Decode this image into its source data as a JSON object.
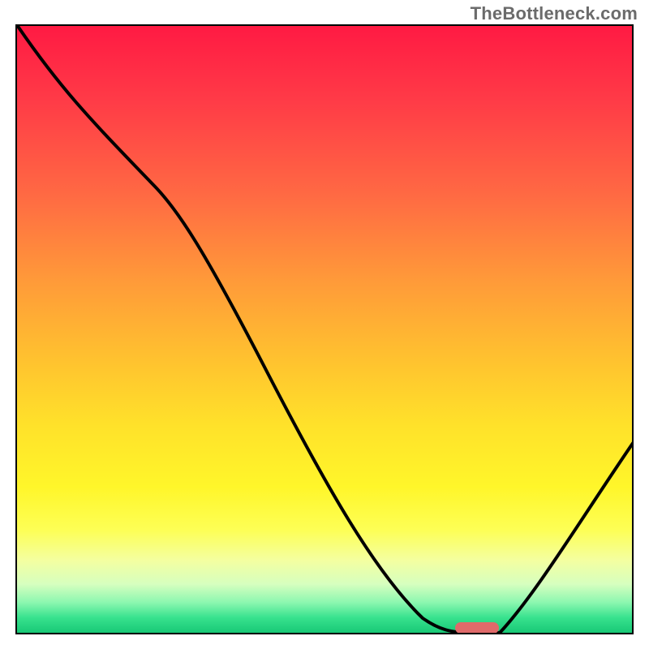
{
  "watermark": "TheBottleneck.com",
  "colors": {
    "border": "#000000",
    "line": "#000000",
    "marker": "#e06a6a",
    "watermark_text": "#6b6b6b"
  },
  "chart_data": {
    "type": "line",
    "title": "",
    "xlabel": "",
    "ylabel": "",
    "xlim": [
      0,
      100
    ],
    "ylim": [
      0,
      100
    ],
    "grid": false,
    "series": [
      {
        "name": "bottleneck-curve",
        "x": [
          0,
          14,
          23,
          63,
          71,
          76,
          100
        ],
        "values": [
          100,
          82,
          73,
          4,
          0,
          0,
          32
        ]
      }
    ],
    "marker": {
      "x_start": 71,
      "x_end": 78,
      "y": 0
    },
    "background_gradient_stops": [
      {
        "pos": 0,
        "color": "#ff1a43"
      },
      {
        "pos": 12,
        "color": "#ff3a47"
      },
      {
        "pos": 28,
        "color": "#ff6a43"
      },
      {
        "pos": 42,
        "color": "#ff9a39"
      },
      {
        "pos": 55,
        "color": "#ffc22f"
      },
      {
        "pos": 66,
        "color": "#ffe22a"
      },
      {
        "pos": 76,
        "color": "#fff62a"
      },
      {
        "pos": 83,
        "color": "#fdff55"
      },
      {
        "pos": 88,
        "color": "#f4ffa0"
      },
      {
        "pos": 92,
        "color": "#d6ffbf"
      },
      {
        "pos": 95,
        "color": "#8cf7b0"
      },
      {
        "pos": 97.5,
        "color": "#38e28e"
      },
      {
        "pos": 100,
        "color": "#18c876"
      }
    ]
  }
}
